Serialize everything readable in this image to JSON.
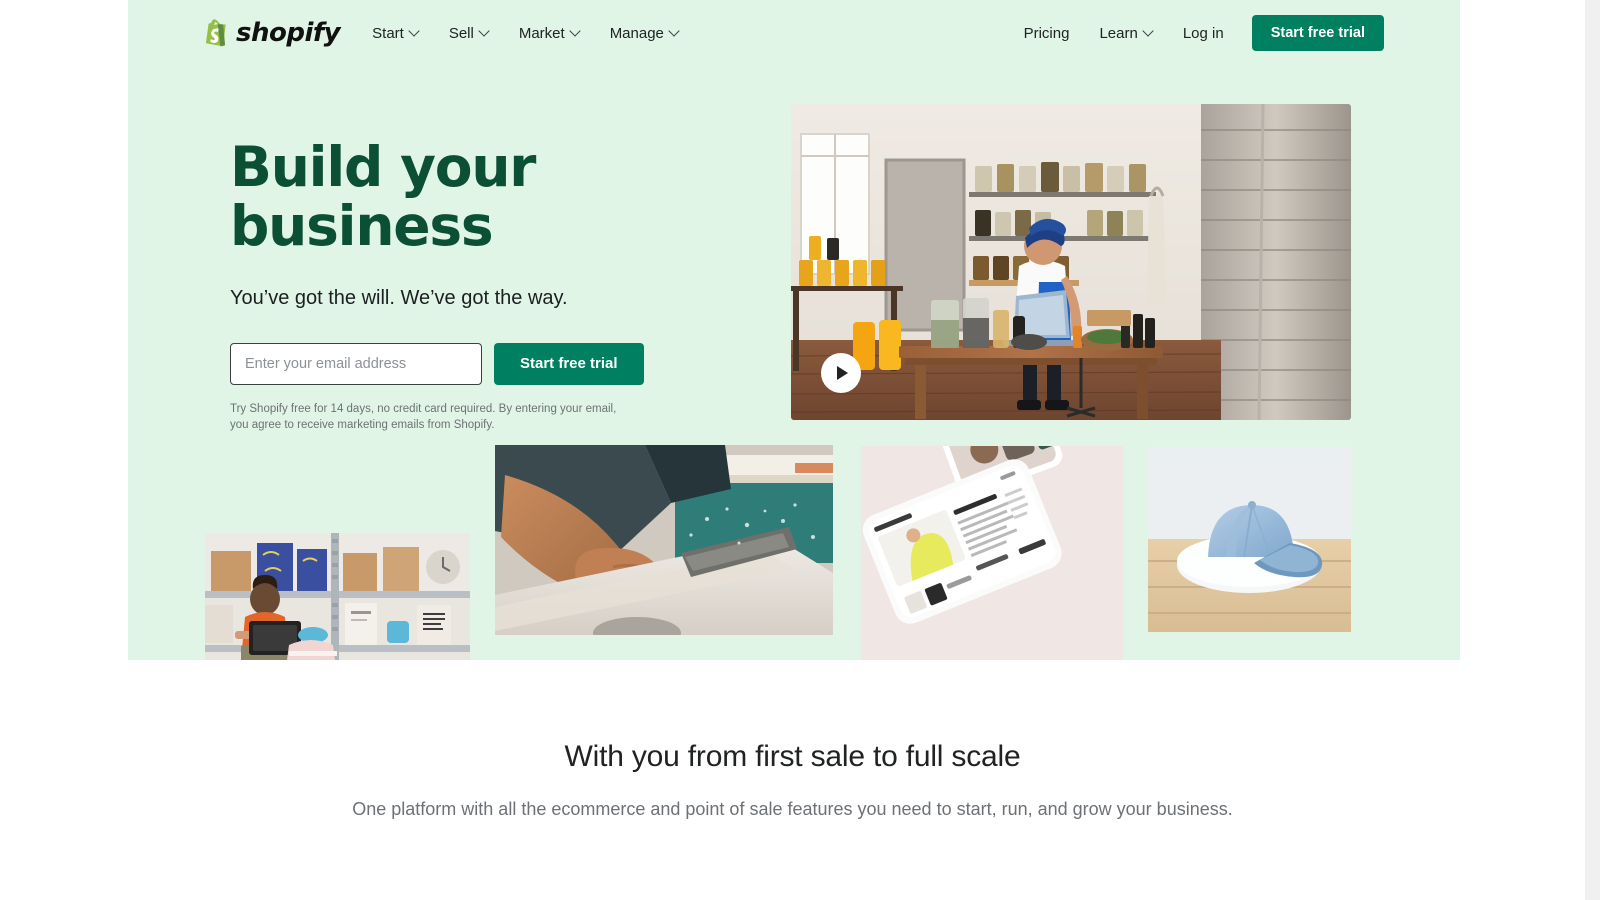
{
  "brand": {
    "logo_word": "shopify",
    "logo_icon": "shopify-bag-icon",
    "accent_green": "#008060",
    "hero_bg": "#e1f5e7",
    "headline_green": "#0b4f35"
  },
  "nav": {
    "items": [
      {
        "label": "Start",
        "has_dropdown": true
      },
      {
        "label": "Sell",
        "has_dropdown": true
      },
      {
        "label": "Market",
        "has_dropdown": true
      },
      {
        "label": "Manage",
        "has_dropdown": true
      }
    ],
    "right_items": [
      {
        "label": "Pricing",
        "has_dropdown": false
      },
      {
        "label": "Learn",
        "has_dropdown": true
      },
      {
        "label": "Log in",
        "has_dropdown": false
      }
    ],
    "cta_label": "Start free trial"
  },
  "hero": {
    "headline": "Build your business",
    "subhead": "You’ve got the will. We’ve got the way.",
    "email_placeholder": "Enter your email address",
    "email_value": "",
    "cta_label": "Start free trial",
    "disclaimer": "Try Shopify free for 14 days, no credit card required. By entering your email, you agree to receive marketing emails from Shopify.",
    "video": {
      "alt": "Woman working on a laptop at a wooden table in a workshop with shelves of jars",
      "play_icon": "play-icon"
    },
    "gallery": [
      {
        "alt": "Person with tablet checking inventory on warehouse shelving"
      },
      {
        "alt": "Hands shaping material on a workbench"
      },
      {
        "alt": "Smartphones displaying an online store product page"
      },
      {
        "alt": "Light blue baseball cap on a white plate on a wooden table"
      }
    ]
  },
  "lower": {
    "title": "With you from first sale to full scale",
    "subtitle": "One platform with all the ecommerce and point of sale features you need to start, run, and grow your business."
  }
}
